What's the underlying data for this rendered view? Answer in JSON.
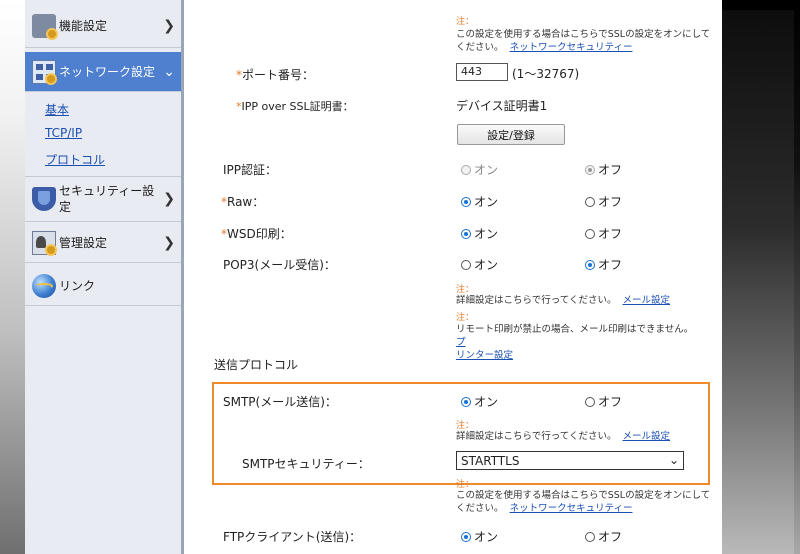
{
  "sidebar": {
    "items": [
      {
        "label": "機能設定",
        "icon": "function-settings-icon"
      },
      {
        "label": "ネットワーク設定",
        "icon": "network-settings-icon",
        "active": true
      },
      {
        "label": "セキュリティー設定",
        "label_line1": "セキュリティー設",
        "label_line2": "定",
        "icon": "security-settings-icon"
      },
      {
        "label": "管理設定",
        "icon": "management-settings-icon"
      },
      {
        "label": "リンク",
        "icon": "link-globe-icon"
      }
    ],
    "subitems": [
      "基本",
      "TCP/IP",
      "プロトコル"
    ]
  },
  "main": {
    "top_note": {
      "head": "注：",
      "text_line1": "この設定を使用する場合はこちらでSSLの設定をオンにして",
      "text_line2": "ください。",
      "link": "ネットワークセキュリティー"
    },
    "port": {
      "label": "ポート番号：",
      "value": "443",
      "range": "(1〜32767)"
    },
    "ipp_ssl_cert": {
      "label": "IPP over SSL証明書：",
      "value": "デバイス証明書1"
    },
    "settings_button": "設定/登録",
    "rows": [
      {
        "label": "IPP認証：",
        "on": "オン",
        "off": "オフ",
        "selected": "off",
        "disabled": true
      },
      {
        "label": "Raw：",
        "on": "オン",
        "off": "オフ",
        "selected": "on"
      },
      {
        "label": "WSD印刷：",
        "on": "オン",
        "off": "オフ",
        "selected": "on"
      },
      {
        "label": "POP3(メール受信)：",
        "on": "オン",
        "off": "オフ",
        "selected": "off"
      }
    ],
    "pop3_notes": {
      "note1_head": "注：",
      "note1_text": "詳細設定はこちらで行ってください。",
      "note1_link": "メール設定",
      "note2_head": "注：",
      "note2_text": "リモート印刷が禁止の場合、メール印刷はできません。",
      "note2_link_a": "プ",
      "note2_link_b": "リンター設定"
    },
    "send_protocol_title": "送信プロトコル",
    "smtp": {
      "label": "SMTP(メール送信)：",
      "on": "オン",
      "off": "オフ",
      "selected": "on",
      "note_head": "注：",
      "note_text": "詳細設定はこちらで行ってください。",
      "note_link": "メール設定"
    },
    "smtp_security": {
      "label": "SMTPセキュリティー：",
      "value": "STARTTLS"
    },
    "bottom_note": {
      "head": "注：",
      "text_line1": "この設定を使用する場合はこちらでSSLの設定をオンにして",
      "text_line2": "ください。",
      "link": "ネットワークセキュリティー"
    },
    "ftp": {
      "label": "FTPクライアント(送信)：",
      "on": "オン",
      "off": "オフ",
      "selected": "on"
    }
  },
  "colors": {
    "highlight_border": "#ef8a2b",
    "active_nav": "#4f7fcf",
    "link": "#1a4fb3",
    "required_mark": "#e37b2b"
  }
}
